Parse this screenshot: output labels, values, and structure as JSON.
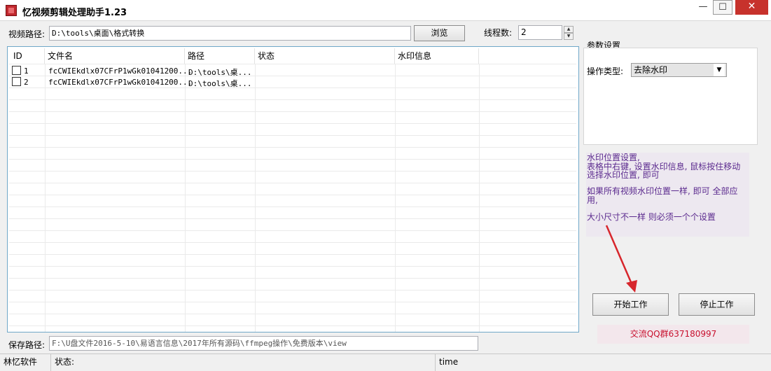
{
  "window": {
    "title": "忆视频剪辑处理助手1.23"
  },
  "path_row": {
    "video_path_label": "视频路径:",
    "video_path_value": "D:\\tools\\桌面\\格式转换",
    "browse_button": "浏览",
    "thread_label": "线程数:",
    "thread_value": "2"
  },
  "table": {
    "columns": [
      "ID",
      "文件名",
      "路径",
      "状态",
      "水印信息"
    ],
    "rows": [
      {
        "id": "1",
        "filename": "fcCWIEkdlx07CFrP1wGk01041200...",
        "path": "D:\\tools\\桌...",
        "status": "",
        "watermark": ""
      },
      {
        "id": "2",
        "filename": "fcCWIEkdlx07CFrP1wGk01041200...",
        "path": "D:\\tools\\桌...",
        "status": "",
        "watermark": ""
      }
    ]
  },
  "params": {
    "group_title": "参数设置",
    "op_type_label": "操作类型:",
    "op_type_value": "去除水印"
  },
  "info": {
    "line1": "水印位置设置,",
    "line2": "表格中右键, 设置水印信息, 鼠标按住移动",
    "line3": "选择水印位置, 即可",
    "line4": "如果所有视频水印位置一样, 即可 全部应",
    "line5": "用,",
    "line6": "大小尺寸不一样 则必须一个个设置"
  },
  "actions": {
    "start_button": "开始工作",
    "stop_button": "停止工作"
  },
  "qq_group": "交流QQ群637180997",
  "save_row": {
    "label": "保存路径:",
    "value": "F:\\U盘文件2016-5-10\\易语言信息\\2017年所有源码\\ffmpeg操作\\免费版本\\view"
  },
  "statusbar": {
    "company": "林忆软件",
    "status_label": "状态:",
    "time": "time"
  },
  "colors": {
    "annotation_arrow": "#d7262c",
    "info_text": "#5b2a8e",
    "qq_text": "#c8102e"
  }
}
